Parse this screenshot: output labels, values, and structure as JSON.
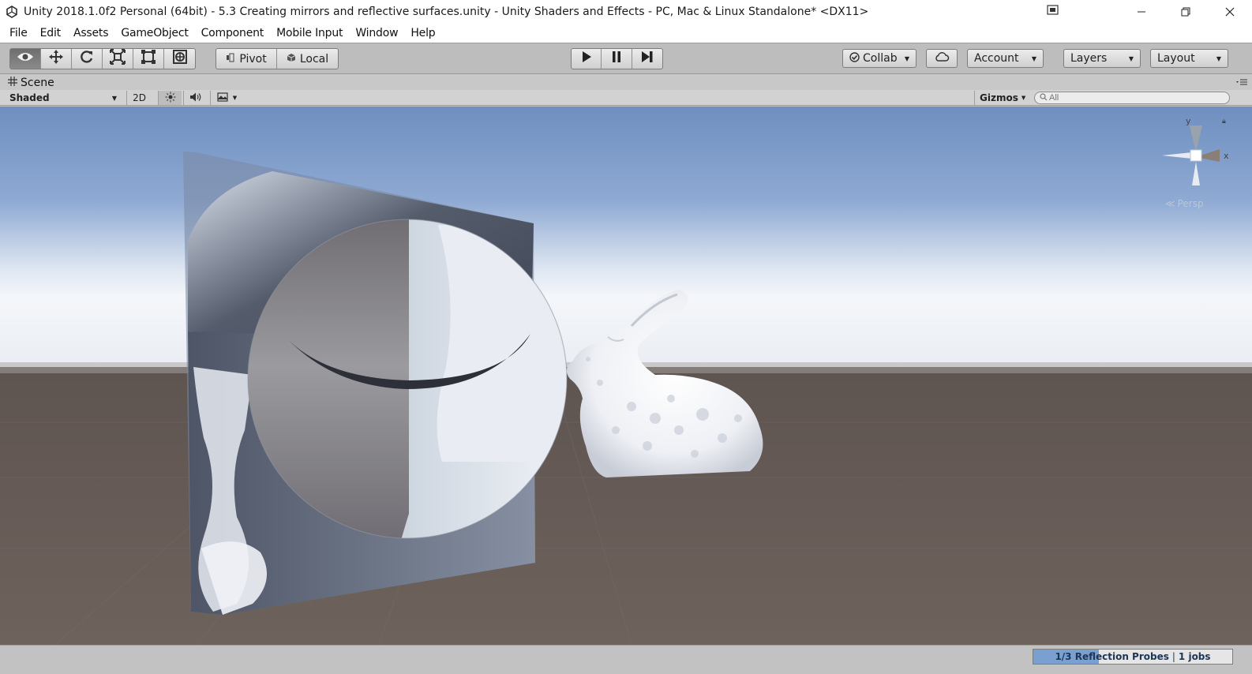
{
  "window": {
    "title": "Unity 2018.1.0f2 Personal (64bit) - 5.3 Creating mirrors and reflective surfaces.unity - Unity Shaders and Effects - PC, Mac & Linux Standalone* <DX11>"
  },
  "menu": {
    "items": [
      "File",
      "Edit",
      "Assets",
      "GameObject",
      "Component",
      "Mobile Input",
      "Window",
      "Help"
    ]
  },
  "toolbar": {
    "transform_tools": [
      {
        "icon": "view-eye-icon"
      },
      {
        "icon": "move-arrows-icon"
      },
      {
        "icon": "rotate-icon"
      },
      {
        "icon": "scale-icon"
      },
      {
        "icon": "rect-transform-icon"
      },
      {
        "icon": "transform-all-icon"
      }
    ],
    "pivot_label": "Pivot",
    "local_label": "Local",
    "collab_label": "Collab",
    "account_label": "Account",
    "layers_label": "Layers",
    "layout_label": "Layout"
  },
  "scene": {
    "tab_label": "Scene",
    "shading_mode": "Shaded",
    "mode_2d_label": "2D",
    "gizmos_label": "Gizmos",
    "search_placeholder": "All",
    "axis_y": "y",
    "axis_x": "x",
    "projection_label": "Persp"
  },
  "status": {
    "progress_text": "1/3 Reflection Probes",
    "jobs_text": "1 jobs",
    "progress_fraction": 0.33
  },
  "colors": {
    "accent": "#7aa0d2",
    "sky_top": "#7a9ac6",
    "ground": "#6a5e56"
  }
}
